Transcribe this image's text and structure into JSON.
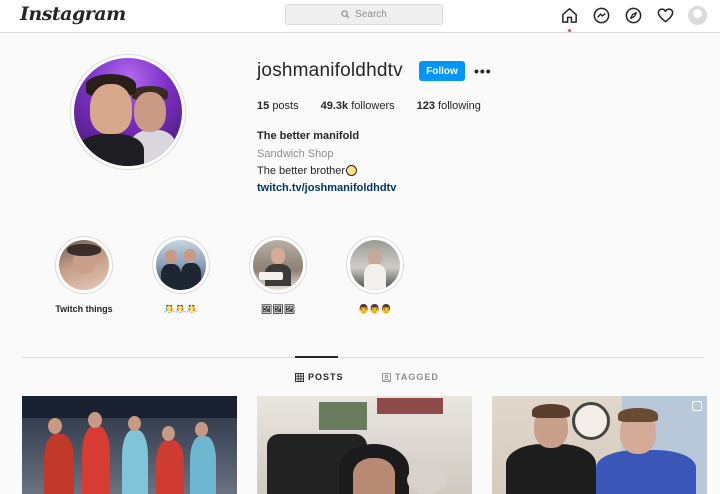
{
  "nav": {
    "logo": "Instagram",
    "search_placeholder": "Search",
    "icons": [
      "home-icon",
      "messenger-icon",
      "explore-icon",
      "heart-icon",
      "profile-avatar"
    ]
  },
  "profile": {
    "username": "joshmanifoldhdtv",
    "follow_label": "Follow",
    "more_label": "•••",
    "stats": {
      "posts_count": "15",
      "posts_label": "posts",
      "followers_count": "49.3k",
      "followers_label": "followers",
      "following_count": "123",
      "following_label": "following"
    },
    "full_name": "The better manifold",
    "category": "Sandwich Shop",
    "bio": "The better brother",
    "link": "twitch.tv/joshmanifoldhdtv"
  },
  "highlights": [
    {
      "label": "Twitch things"
    },
    {
      "label": "🤼🤼🤼"
    },
    {
      "label": "🖼🖼🖼"
    },
    {
      "label": "👨👨👨"
    }
  ],
  "tabs": {
    "posts": "POSTS",
    "tagged": "TAGGED"
  },
  "colors": {
    "accent": "#0095f6",
    "link": "#00376b",
    "notification": "#ed4956"
  }
}
